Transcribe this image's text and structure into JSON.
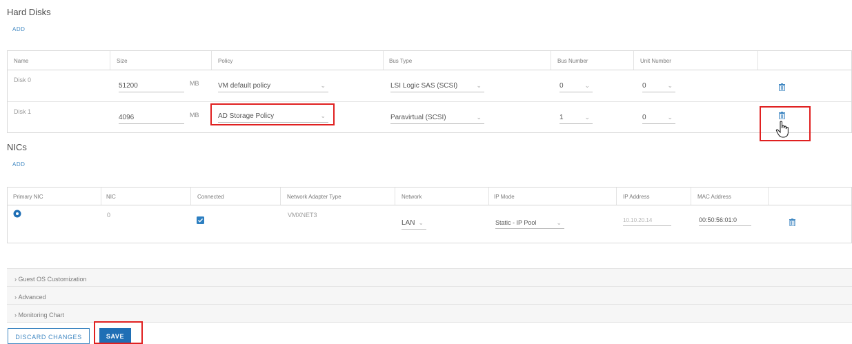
{
  "hard_disks": {
    "title": "Hard Disks",
    "add_label": "ADD",
    "columns": [
      "Name",
      "Size",
      "Policy",
      "Bus Type",
      "Bus Number",
      "Unit Number"
    ],
    "rows": [
      {
        "name": "Disk 0",
        "size": "51200",
        "unit": "MB",
        "policy": "VM default policy",
        "bus_type": "LSI Logic SAS (SCSI)",
        "bus_number": "0",
        "unit_number": "0"
      },
      {
        "name": "Disk 1",
        "size": "4096",
        "unit": "MB",
        "policy": "AD Storage Policy",
        "bus_type": "Paravirtual (SCSI)",
        "bus_number": "1",
        "unit_number": "0"
      }
    ]
  },
  "nics": {
    "title": "NICs",
    "add_label": "ADD",
    "columns": [
      "Primary NIC",
      "NIC",
      "Connected",
      "Network Adapter Type",
      "Network",
      "IP Mode",
      "IP Address",
      "MAC Address"
    ],
    "rows": [
      {
        "nic": "0",
        "adapter_type": "VMXNET3",
        "network": "LAN",
        "ip_mode": "Static - IP Pool",
        "ip_address": "10.10.20.14",
        "mac_address": "00:50:56:01:0"
      }
    ]
  },
  "accordions": {
    "guest_os": "Guest OS Customization",
    "advanced": "Advanced",
    "monitoring": "Monitoring Chart"
  },
  "footer": {
    "discard_label": "DISCARD CHANGES",
    "save_label": "SAVE"
  },
  "colors": {
    "accent": "#3f87c2",
    "save_button": "#1f6fb5",
    "highlight": "#e02020"
  },
  "icons": {
    "trash": "trash-icon",
    "radio": "radio-selected-icon",
    "checkbox": "checkbox-checked-icon",
    "chevron": "chevron-down-icon",
    "cursor": "hand-pointer-icon"
  }
}
